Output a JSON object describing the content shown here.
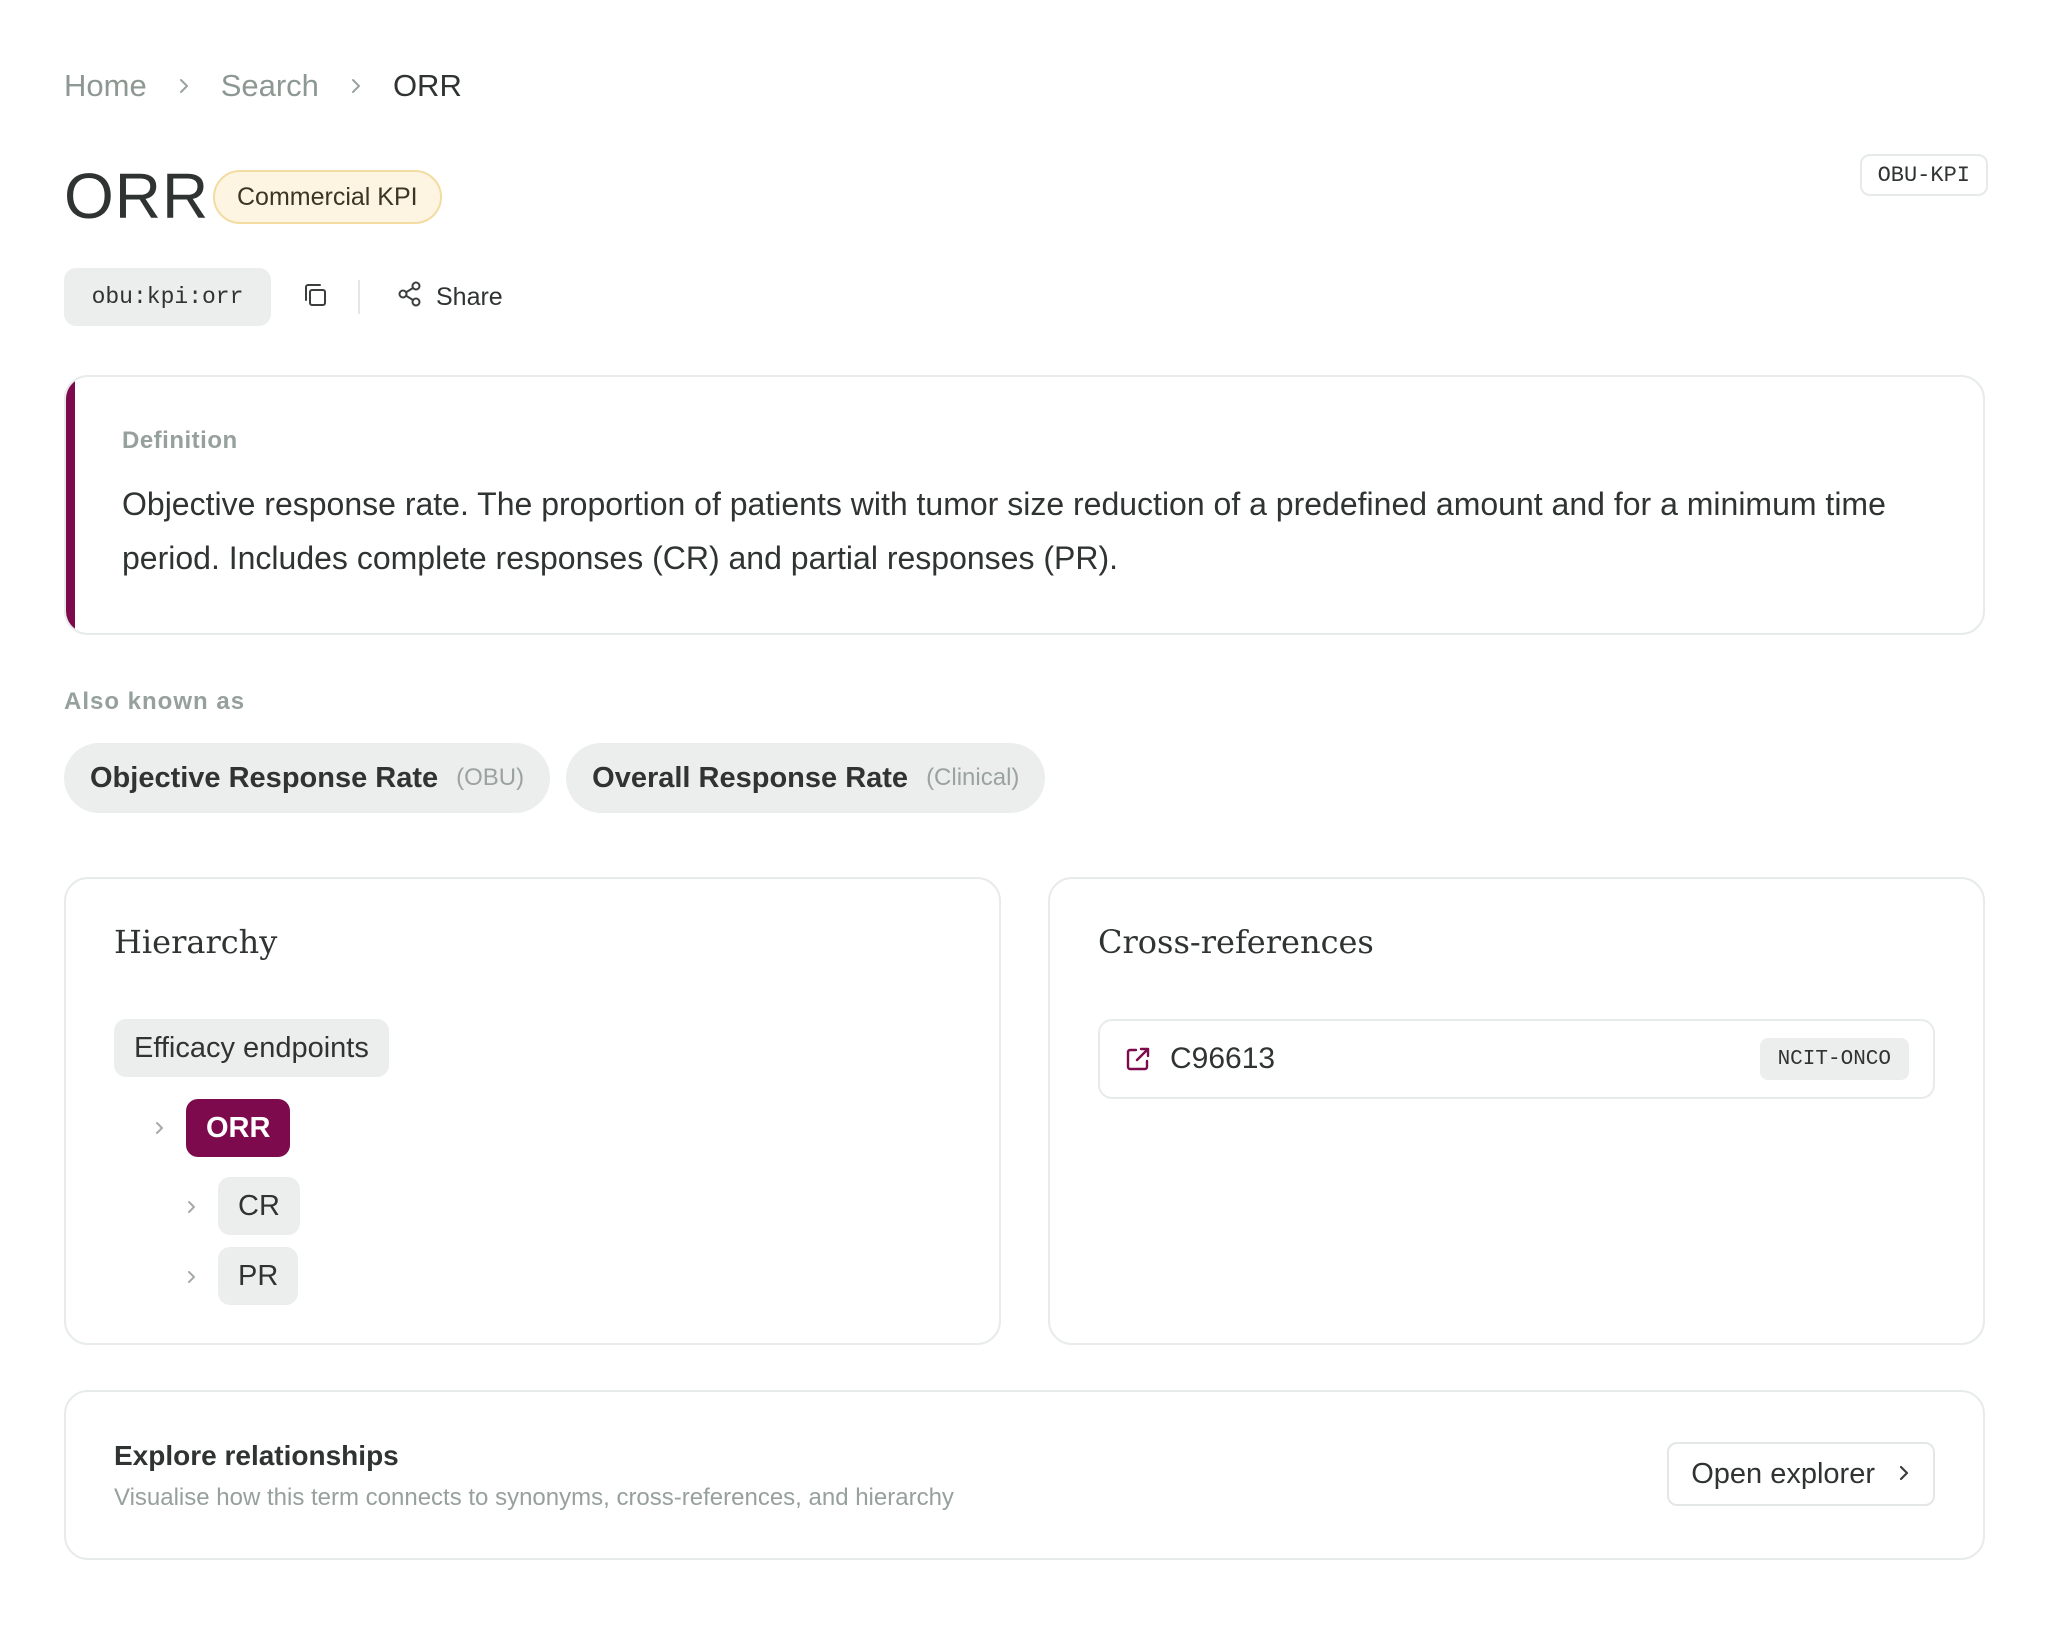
{
  "breadcrumb": {
    "items": [
      "Home",
      "Search",
      "ORR"
    ]
  },
  "term": {
    "title": "ORR",
    "category_badge": "Commercial KPI",
    "vocab_code": "OBU-KPI",
    "id": "obu:kpi:orr",
    "share_label": "Share"
  },
  "definition": {
    "label": "Definition",
    "text": "Objective response rate. The proportion of patients with tumor size reduction of a predefined amount and for a minimum time period. Includes complete responses (CR) and partial responses (PR)."
  },
  "aka": {
    "label": "Also known as",
    "items": [
      {
        "name": "Objective Response Rate",
        "source": "(OBU)"
      },
      {
        "name": "Overall Response Rate",
        "source": "(Clinical)"
      }
    ]
  },
  "hierarchy": {
    "title": "Hierarchy",
    "parent": "Efficacy endpoints",
    "current": "ORR",
    "children": [
      "CR",
      "PR"
    ]
  },
  "xrefs": {
    "title": "Cross-references",
    "items": [
      {
        "code": "C96613",
        "vocab": "NCIT-ONCO"
      }
    ]
  },
  "explore": {
    "title": "Explore relationships",
    "subtitle": "Visualise how this term connects to synonyms, cross-references, and hierarchy",
    "button_label": "Open explorer"
  },
  "colors": {
    "accent": "#7d0a4c",
    "badge_bg": "#fdf5e1",
    "pill_bg": "#eceeee"
  },
  "icons": [
    "chevron-right-icon",
    "copy-icon",
    "share-icon",
    "external-link-icon"
  ]
}
